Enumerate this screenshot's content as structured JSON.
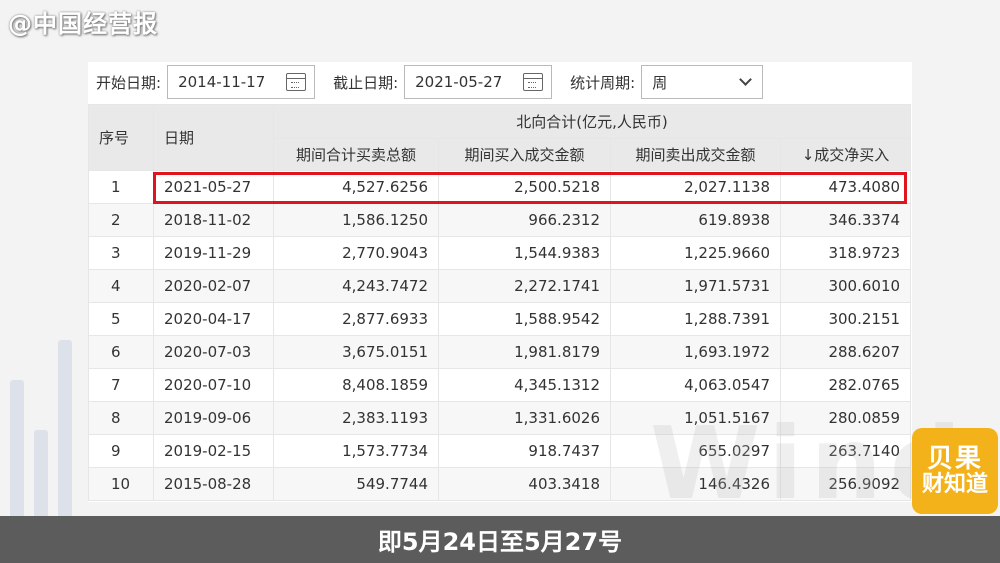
{
  "watermark": "@中国经营报",
  "filters": {
    "start_label": "开始日期:",
    "start_value": "2014-11-17",
    "end_label": "截止日期:",
    "end_value": "2021-05-27",
    "period_label": "统计周期:",
    "period_value": "周"
  },
  "table": {
    "col_index": "序号",
    "col_date": "日期",
    "group_header": "北向合计(亿元,人民币)",
    "sub_headers": [
      "期间合计买卖总额",
      "期间买入成交金额",
      "期间卖出成交金额",
      "↓成交净买入"
    ],
    "rows": [
      [
        "1",
        "2021-05-27",
        "4,527.6256",
        "2,500.5218",
        "2,027.1138",
        "473.4080"
      ],
      [
        "2",
        "2018-11-02",
        "1,586.1250",
        "966.2312",
        "619.8938",
        "346.3374"
      ],
      [
        "3",
        "2019-11-29",
        "2,770.9043",
        "1,544.9383",
        "1,225.9660",
        "318.9723"
      ],
      [
        "4",
        "2020-02-07",
        "4,243.7472",
        "2,272.1741",
        "1,971.5731",
        "300.6010"
      ],
      [
        "5",
        "2020-04-17",
        "2,877.6933",
        "1,588.9542",
        "1,288.7391",
        "300.2151"
      ],
      [
        "6",
        "2020-07-03",
        "3,675.0151",
        "1,981.8179",
        "1,693.1972",
        "288.6207"
      ],
      [
        "7",
        "2020-07-10",
        "8,408.1859",
        "4,345.1312",
        "4,063.0547",
        "282.0765"
      ],
      [
        "8",
        "2019-09-06",
        "2,383.1193",
        "1,331.6026",
        "1,051.5167",
        "280.0859"
      ],
      [
        "9",
        "2019-02-15",
        "1,573.7734",
        "918.7437",
        "655.0297",
        "263.7140"
      ],
      [
        "10",
        "2015-08-28",
        "549.7744",
        "403.3418",
        "146.4326",
        "256.9092"
      ]
    ]
  },
  "win_watermark": "Wind",
  "logo": {
    "line1": "贝果",
    "line2": "财知道",
    "color": "#f3b11a"
  },
  "caption": "即5月24日至5月27号",
  "colors": {
    "highlight": "#e0141e",
    "header_bg": "#e9e9e9",
    "caption_bg": "#5c5c5c"
  }
}
